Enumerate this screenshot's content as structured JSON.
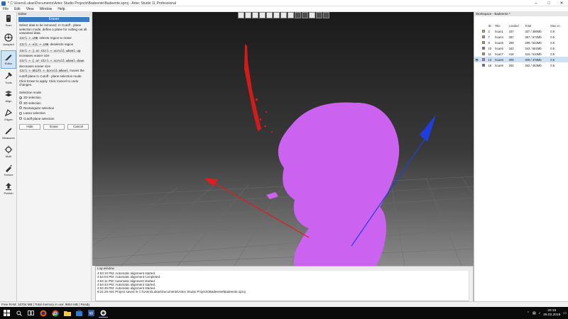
{
  "window": {
    "title": "* C:\\Users\\Lukas\\Documents\\Artec Studio Projects\\Badeente\\Badeente.sproj - Artec Studio 11 Professional"
  },
  "menu": [
    "File",
    "Edit",
    "View",
    "Window",
    "Help"
  ],
  "toolbar": {
    "items": [
      {
        "label": "Scan",
        "icon": "scan-icon"
      },
      {
        "label": "Autopilot",
        "icon": "autopilot-icon"
      },
      {
        "label": "Editor",
        "icon": "editor-icon",
        "active": true
      },
      {
        "label": "Tools",
        "icon": "tools-icon"
      },
      {
        "label": "Align",
        "icon": "align-icon"
      },
      {
        "label": "Edges",
        "icon": "edges-icon"
      },
      {
        "label": "Measures",
        "icon": "measures-icon"
      },
      {
        "label": "Multi",
        "icon": "multi-icon"
      },
      {
        "label": "Texture",
        "icon": "texture-icon"
      },
      {
        "label": "Publish",
        "icon": "publish-icon"
      }
    ]
  },
  "editor": {
    "panel_title": "Editor",
    "header": "Eraser",
    "help_intro": "Select data to be removed. In Cutoff - plane selection mode, define a plane for cutting out all unwanted data.",
    "help_lines": [
      {
        "key": "Ctrl + LMB",
        "text": "selects region to erase"
      },
      {
        "key": "Ctrl + Alt + LMB",
        "text": "deselects region"
      },
      {
        "key": "Ctrl + ] or Ctrl + scroll wheel up",
        "text": "increases eraser size"
      },
      {
        "key": "Ctrl + [ or Ctrl + scroll wheel down",
        "text": "decreases eraser size"
      },
      {
        "key": "Ctrl + Shift + Scroll Wheel",
        "text": "moves the cutoff plane in Cutoff - plane selection mode"
      }
    ],
    "help_outro": "Click Erase to apply. Click Cancel to undo changes.",
    "mode_label": "Selection mode",
    "modes": [
      {
        "label": "2D selection",
        "selected": true
      },
      {
        "label": "3D selection",
        "selected": false
      },
      {
        "label": "Rectangular selection",
        "selected": false
      },
      {
        "label": "Lasso selection",
        "selected": false
      },
      {
        "label": "Cutoff-plane selection",
        "selected": false
      }
    ],
    "buttons": {
      "hide": "Hide",
      "erase": "Erase",
      "cancel": "Cancel"
    }
  },
  "workspace": {
    "title": "Workspace - Badeente *",
    "columns": [
      "ID",
      "Title",
      "Loaded",
      "Total",
      "Max er..."
    ],
    "rows": [
      {
        "id": "2",
        "title": "Scan1",
        "loaded": "337",
        "total": "337 / 386Mb",
        "max": "0.5",
        "color": "#d9a06b",
        "visible": false,
        "selected": false
      },
      {
        "id": "7",
        "title": "Scan4",
        "loaded": "387",
        "total": "387 / 572Mb",
        "max": "0.5",
        "color": "#d08a4f",
        "visible": false,
        "selected": false
      },
      {
        "id": "8",
        "title": "Scan5",
        "loaded": "299",
        "total": "299 / 523Mb",
        "max": "0.5",
        "color": "#c58f6a",
        "visible": false,
        "selected": false
      },
      {
        "id": "10",
        "title": "Scan6",
        "loaded": "343",
        "total": "343 / 561Mb",
        "max": "0.5",
        "color": "#8a5ab3",
        "visible": false,
        "selected": false
      },
      {
        "id": "11",
        "title": "Scan7",
        "loaded": "416",
        "total": "416 / 510Mb",
        "max": "0.5",
        "color": "#d38d52",
        "visible": false,
        "selected": false
      },
      {
        "id": "13",
        "title": "Scan8",
        "loaded": "309",
        "total": "309 / 478Mb",
        "max": "0.5",
        "color": "#c863e8",
        "visible": true,
        "selected": true
      },
      {
        "id": "16",
        "title": "Scan9",
        "loaded": "262",
        "total": "262 / 453Mb",
        "max": "0.5",
        "color": "#5660c8",
        "visible": false,
        "selected": false
      }
    ]
  },
  "log": {
    "title": "Log window",
    "lines": [
      "4:53:10 PM: Automatic alignment started.",
      "4:54:04 PM: Automatic alignment completed.",
      "4:54:11 PM: Automatic alignment started.",
      "4:54:43 PM: Automatic alignment started.",
      "4:54:45 PM: Automatic alignment started.",
      "8:21:29 AM: Project saved in C:\\Users\\Lukas\\Documents\\Artec Studio Projects\\Badeente\\Badeente.sproj"
    ]
  },
  "status": {
    "text": "Free RAM: 16704 MB  |  Total memory in use: 9804 MB  |  Ready"
  },
  "taskbar": {
    "time": "20:16",
    "date": "26.02.2018",
    "apps": [
      "start-icon",
      "search-icon",
      "task-view-icon",
      "firefox-icon",
      "chrome-icon",
      "file-explorer-icon",
      "store-icon",
      "word-icon",
      "artec-icon"
    ]
  },
  "colors": {
    "accent": "#3a7bc8",
    "scan": "#cc63f0",
    "axis_red": "#e21c1c",
    "axis_blue": "#1f3ee0"
  }
}
